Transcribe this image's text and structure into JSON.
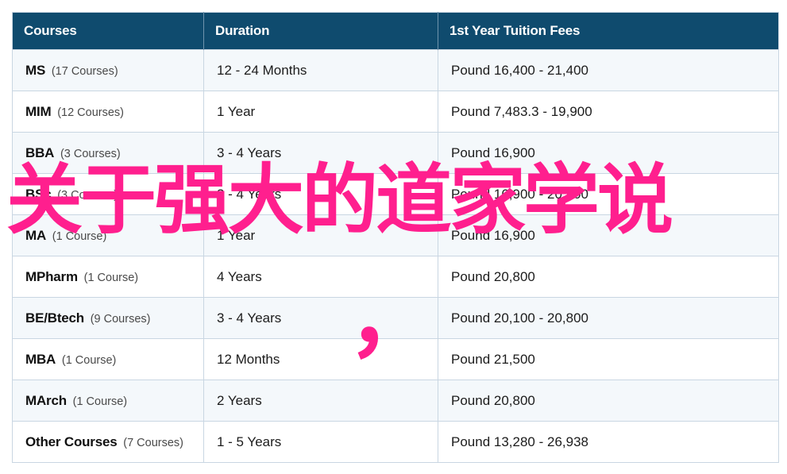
{
  "table": {
    "headers": [
      "Courses",
      "Duration",
      "1st Year Tuition Fees"
    ],
    "rows": [
      {
        "course": "MS",
        "count": "(17 Courses)",
        "duration": "12 - 24 Months",
        "fees": "Pound 16,400 - 21,400"
      },
      {
        "course": "MIM",
        "count": "(12 Courses)",
        "duration": "1 Year",
        "fees": "Pound 7,483.3 - 19,900"
      },
      {
        "course": "BBA",
        "count": "(3 Courses)",
        "duration": "3 - 4 Years",
        "fees": "Pound 16,900"
      },
      {
        "course": "BSc",
        "count": "(3 Courses)",
        "duration": "3 - 4 Years",
        "fees": "Pound 16,900 - 20,800"
      },
      {
        "course": "MA",
        "count": "(1 Course)",
        "duration": "1 Year",
        "fees": "Pound 16,900"
      },
      {
        "course": "MPharm",
        "count": "(1 Course)",
        "duration": "4 Years",
        "fees": "Pound 20,800"
      },
      {
        "course": "BE/Btech",
        "count": "(9 Courses)",
        "duration": "3 - 4 Years",
        "fees": "Pound 20,100 - 20,800"
      },
      {
        "course": "MBA",
        "count": "(1 Course)",
        "duration": "12 Months",
        "fees": "Pound 21,500"
      },
      {
        "course": "MArch",
        "count": "(1 Course)",
        "duration": "2 Years",
        "fees": "Pound 20,800"
      },
      {
        "course": "Other Courses",
        "count": "(7 Courses)",
        "duration": "1 - 5 Years",
        "fees": "Pound 13,280 - 26,938"
      }
    ]
  },
  "overlay": {
    "title": "关于强大的道家学说",
    "punctuation": "，"
  },
  "colors": {
    "header_background": "#0f4b6e",
    "header_text": "#ffffff",
    "overlay_text": "#ff1f8e",
    "stripe_row": "#f4f8fb",
    "border": "#c9d6e2"
  }
}
